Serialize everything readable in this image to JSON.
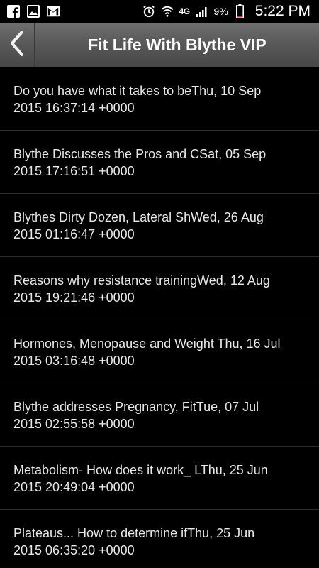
{
  "status_bar": {
    "battery_percent": "9%",
    "network": "4G",
    "time": "5:22 PM",
    "icons": [
      "facebook-icon",
      "gallery-icon",
      "gmail-icon",
      "alarm-icon",
      "wifi-icon",
      "signal-icon",
      "battery-icon"
    ]
  },
  "header": {
    "title": "Fit Life With Blythe VIP",
    "back_icon": "chevron-left-icon"
  },
  "colors": {
    "background": "#000000",
    "header_top": "#6f6f6f",
    "header_bottom": "#474747",
    "text": "#e8e8e8",
    "divider": "#2e2e2e",
    "battery_low": "#d32f2f"
  },
  "items": [
    {
      "line1": "Do you have what it takes to beThu, 10 Sep",
      "line2": "2015 16:37:14 +0000"
    },
    {
      "line1": "Blythe Discusses the Pros and CSat, 05 Sep",
      "line2": "2015 17:16:51 +0000"
    },
    {
      "line1": "Blythes Dirty Dozen, Lateral ShWed, 26 Aug",
      "line2": "2015 01:16:47 +0000"
    },
    {
      "line1": "Reasons why resistance trainingWed, 12 Aug",
      "line2": "2015 19:21:46 +0000"
    },
    {
      "line1": "Hormones, Menopause and Weight Thu, 16 Jul",
      "line2": "2015 03:16:48 +0000"
    },
    {
      "line1": "Blythe addresses Pregnancy, FitTue, 07 Jul",
      "line2": "2015 02:55:58 +0000"
    },
    {
      "line1": "Metabolism- How does it work_ LThu, 25 Jun",
      "line2": "2015 20:49:04 +0000"
    },
    {
      "line1": "Plateaus... How to determine ifThu, 25 Jun",
      "line2": "2015 06:35:20 +0000"
    }
  ]
}
